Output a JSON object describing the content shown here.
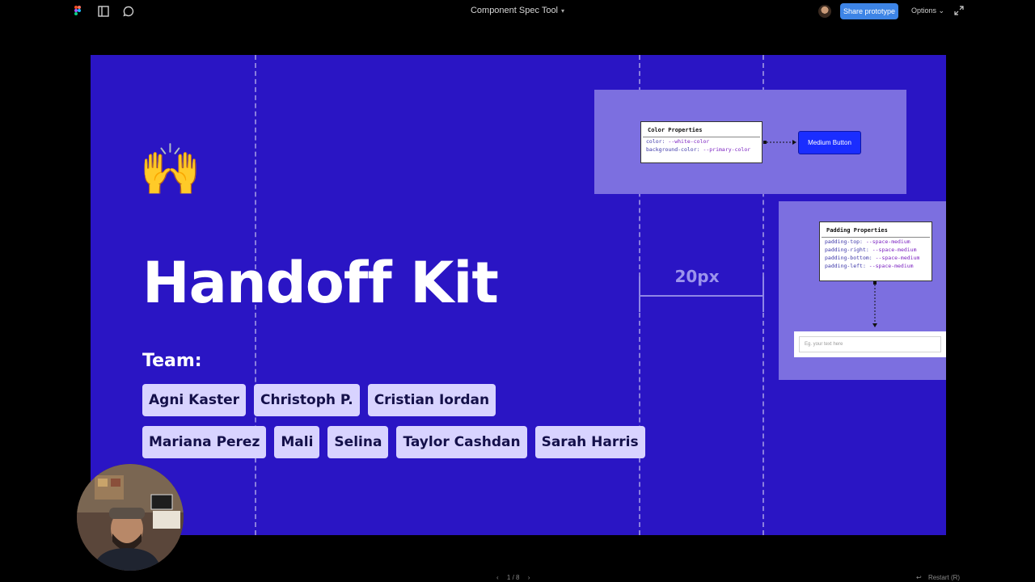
{
  "app": {
    "title": "Component Spec Tool",
    "share_label": "Share prototype",
    "options_label": "Options",
    "accent": "#3d84e6"
  },
  "slide": {
    "background": "#2a15c4",
    "emoji": "🙌",
    "heading": "Handoff Kit",
    "team_label": "Team:",
    "team_row1": [
      "Agni Kaster",
      "Christoph P.",
      "Cristian Iordan"
    ],
    "team_row2": [
      "Mariana Perez",
      "Mali",
      "Selina",
      "Taylor Cashdan",
      "Sarah Harris"
    ],
    "measure_label": "20px"
  },
  "color_card": {
    "title": "Color Properties",
    "lines": [
      {
        "key": "color:",
        "value": "--white-color"
      },
      {
        "key": "background-color:",
        "value": "--primary-color"
      }
    ],
    "button_label": "Medium Button"
  },
  "padding_card": {
    "title": "Padding Properties",
    "lines": [
      {
        "key": "padding-top:",
        "value": "--space-medium"
      },
      {
        "key": "padding-right:",
        "value": "--space-medium"
      },
      {
        "key": "padding-bottom:",
        "value": "--space-medium"
      },
      {
        "key": "padding-left:",
        "value": "--space-medium"
      }
    ],
    "input_placeholder": "Eg. your text here"
  },
  "footer": {
    "page": "1 / 8",
    "restart": "Restart (R)"
  },
  "icons": [
    "figma-logo-icon",
    "sidebar-icon",
    "comment-icon",
    "chevron-down-icon",
    "expand-icon",
    "chevron-left-icon",
    "chevron-right-icon",
    "restart-icon"
  ]
}
